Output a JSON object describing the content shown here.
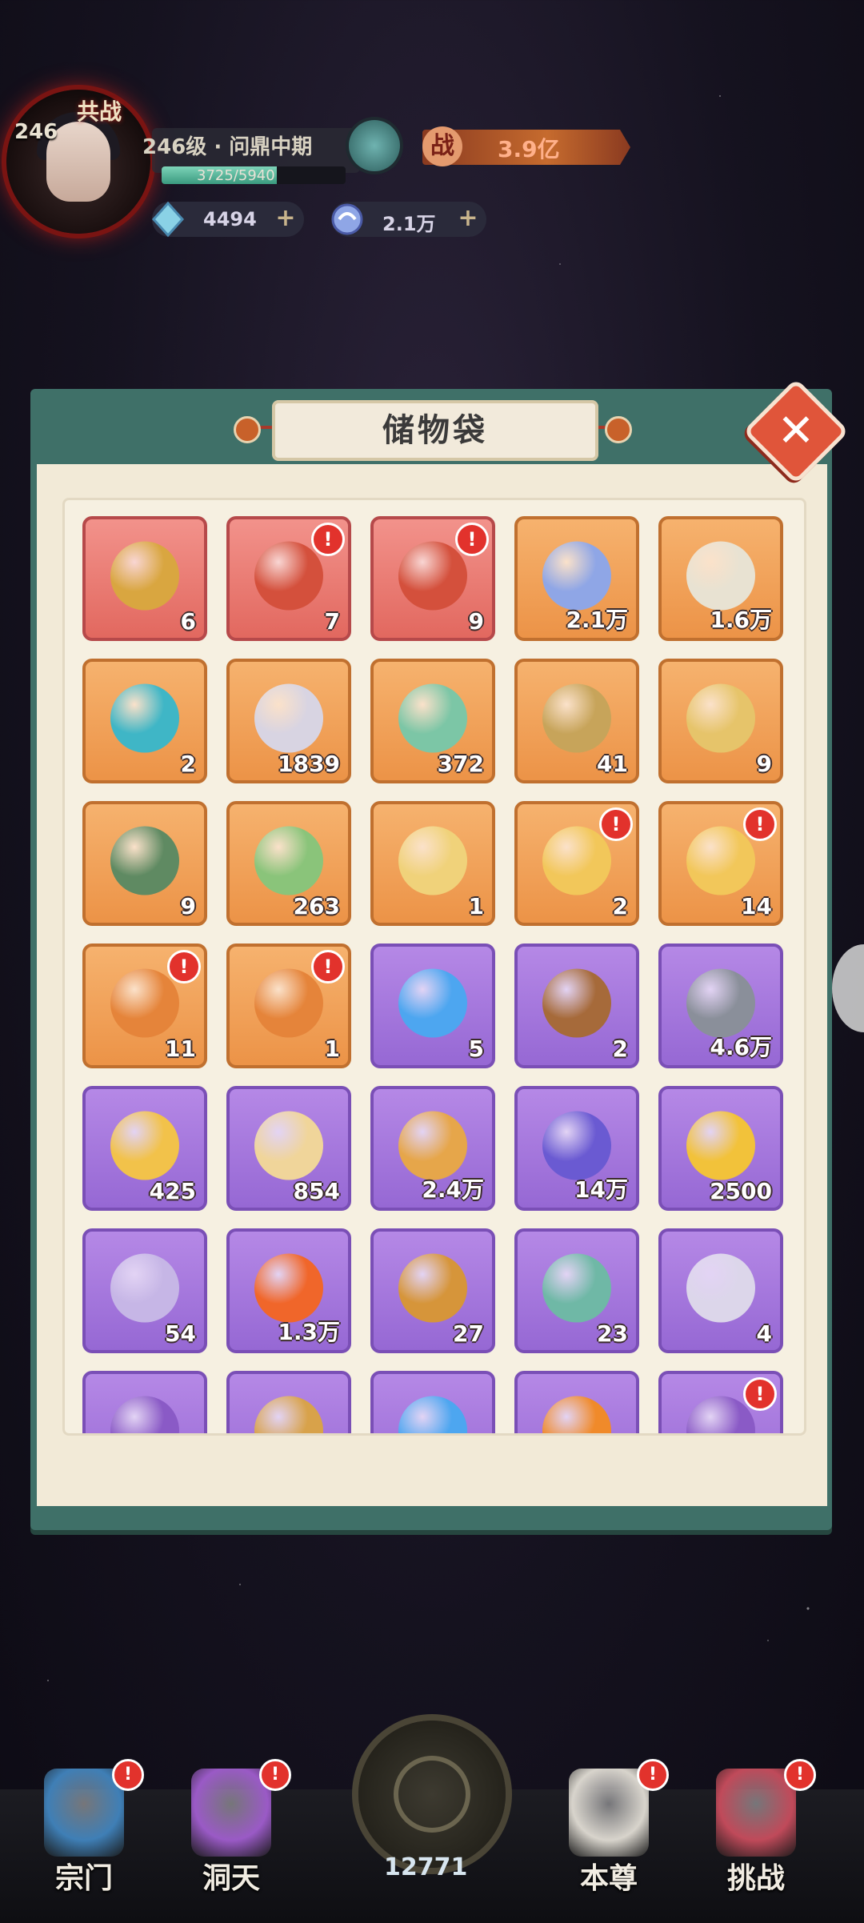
{
  "header": {
    "avatar_level": "246",
    "avatar_tag": "共战",
    "level_label": "246级 · 问鼎中期",
    "exp_text": "3725/5940",
    "exp_fraction": 0.627,
    "power_badge": "战",
    "power_value": "3.9亿",
    "resources": [
      {
        "icon": "diamond-icon",
        "value": "4494",
        "plus": "+"
      },
      {
        "icon": "spirit-stone-icon",
        "value": "2.1万",
        "plus": "+"
      }
    ]
  },
  "panel": {
    "title": "储物袋",
    "close_label": "✕"
  },
  "items": [
    {
      "name": "ring",
      "rarity": "red",
      "count": "6",
      "alert": false,
      "color": "#d9a640"
    },
    {
      "name": "manual",
      "rarity": "red",
      "count": "7",
      "alert": true,
      "color": "#d4503c"
    },
    {
      "name": "manual-choice",
      "rarity": "red",
      "count": "9",
      "alert": true,
      "color": "#d4503c"
    },
    {
      "name": "spirit-stone",
      "rarity": "orange",
      "count": "2.1万",
      "alert": false,
      "color": "#8fa6e6"
    },
    {
      "name": "bone",
      "rarity": "orange",
      "count": "1.6万",
      "alert": false,
      "color": "#e8e2d2"
    },
    {
      "name": "crystal",
      "rarity": "orange",
      "count": "2",
      "alert": false,
      "color": "#3fb6c6"
    },
    {
      "name": "talisman",
      "rarity": "orange",
      "count": "1839",
      "alert": false,
      "color": "#d8d4e2"
    },
    {
      "name": "jade-beast",
      "rarity": "orange",
      "count": "372",
      "alert": false,
      "color": "#7cc6a6"
    },
    {
      "name": "bracelet",
      "rarity": "orange",
      "count": "41",
      "alert": false,
      "color": "#c7a45a"
    },
    {
      "name": "scroll",
      "rarity": "orange",
      "count": "9",
      "alert": false,
      "color": "#e6c46a"
    },
    {
      "name": "book",
      "rarity": "orange",
      "count": "9",
      "alert": false,
      "color": "#5f8a62"
    },
    {
      "name": "map",
      "rarity": "orange",
      "count": "263",
      "alert": false,
      "color": "#8ac47a"
    },
    {
      "name": "orb-stand",
      "rarity": "orange",
      "count": "1",
      "alert": false,
      "color": "#f0d27a"
    },
    {
      "name": "mystery-bag",
      "rarity": "orange",
      "count": "2",
      "alert": true,
      "color": "#f2c75a"
    },
    {
      "name": "treasure-bag",
      "rarity": "orange",
      "count": "14",
      "alert": true,
      "color": "#f2c75a"
    },
    {
      "name": "orange-manual",
      "rarity": "orange",
      "count": "11",
      "alert": true,
      "color": "#e5843a"
    },
    {
      "name": "orange-manual-choice",
      "rarity": "orange",
      "count": "1",
      "alert": true,
      "color": "#e5843a"
    },
    {
      "name": "blue-flame",
      "rarity": "purple",
      "count": "5",
      "alert": false,
      "color": "#4da6f0"
    },
    {
      "name": "brown-flame",
      "rarity": "purple",
      "count": "2",
      "alert": false,
      "color": "#a66a3a"
    },
    {
      "name": "ore",
      "rarity": "purple",
      "count": "4.6万",
      "alert": false,
      "color": "#8a8f9a"
    },
    {
      "name": "gold-crystal",
      "rarity": "purple",
      "count": "425",
      "alert": false,
      "color": "#f2c24a"
    },
    {
      "name": "compass",
      "rarity": "purple",
      "count": "854",
      "alert": false,
      "color": "#f0d59a"
    },
    {
      "name": "medal",
      "rarity": "purple",
      "count": "2.4万",
      "alert": false,
      "color": "#e6a64a"
    },
    {
      "name": "purple-orb",
      "rarity": "purple",
      "count": "14万",
      "alert": false,
      "color": "#6a5ad2"
    },
    {
      "name": "gold-shard",
      "rarity": "purple",
      "count": "2500",
      "alert": false,
      "color": "#f2c23a"
    },
    {
      "name": "silver-ring",
      "rarity": "purple",
      "count": "54",
      "alert": false,
      "color": "#c6b6e6"
    },
    {
      "name": "fire-spirit",
      "rarity": "purple",
      "count": "1.3万",
      "alert": false,
      "color": "#f0662a"
    },
    {
      "name": "fortune-ticket",
      "rarity": "purple",
      "count": "27",
      "alert": false,
      "color": "#d6953a"
    },
    {
      "name": "gourd",
      "rarity": "purple",
      "count": "23",
      "alert": false,
      "color": "#6fb8a6"
    },
    {
      "name": "card",
      "rarity": "purple",
      "count": "4",
      "alert": false,
      "color": "#dcd6ea"
    },
    {
      "name": "purple-manual",
      "rarity": "purple",
      "count": "",
      "alert": false,
      "color": "#8a5ac6"
    },
    {
      "name": "gold-token",
      "rarity": "purple",
      "count": "",
      "alert": false,
      "color": "#d8a24a"
    },
    {
      "name": "blue-flame-2",
      "rarity": "purple",
      "count": "",
      "alert": false,
      "color": "#4da6f0"
    },
    {
      "name": "orange-crystal",
      "rarity": "purple",
      "count": "",
      "alert": false,
      "color": "#f08a2a"
    },
    {
      "name": "purple-manual-2",
      "rarity": "purple",
      "count": "",
      "alert": true,
      "color": "#8a5ac6"
    }
  ],
  "nav": {
    "items": [
      {
        "label": "宗门",
        "alert": true,
        "color": "#3f7fb6"
      },
      {
        "label": "洞天",
        "alert": true,
        "color": "#9a5ac6"
      },
      {
        "label": "本尊",
        "alert": true,
        "color": "#d8d4cc"
      },
      {
        "label": "挑战",
        "alert": true,
        "color": "#c04a5a"
      }
    ],
    "center_count": "12771",
    "alert_mark": "!"
  }
}
